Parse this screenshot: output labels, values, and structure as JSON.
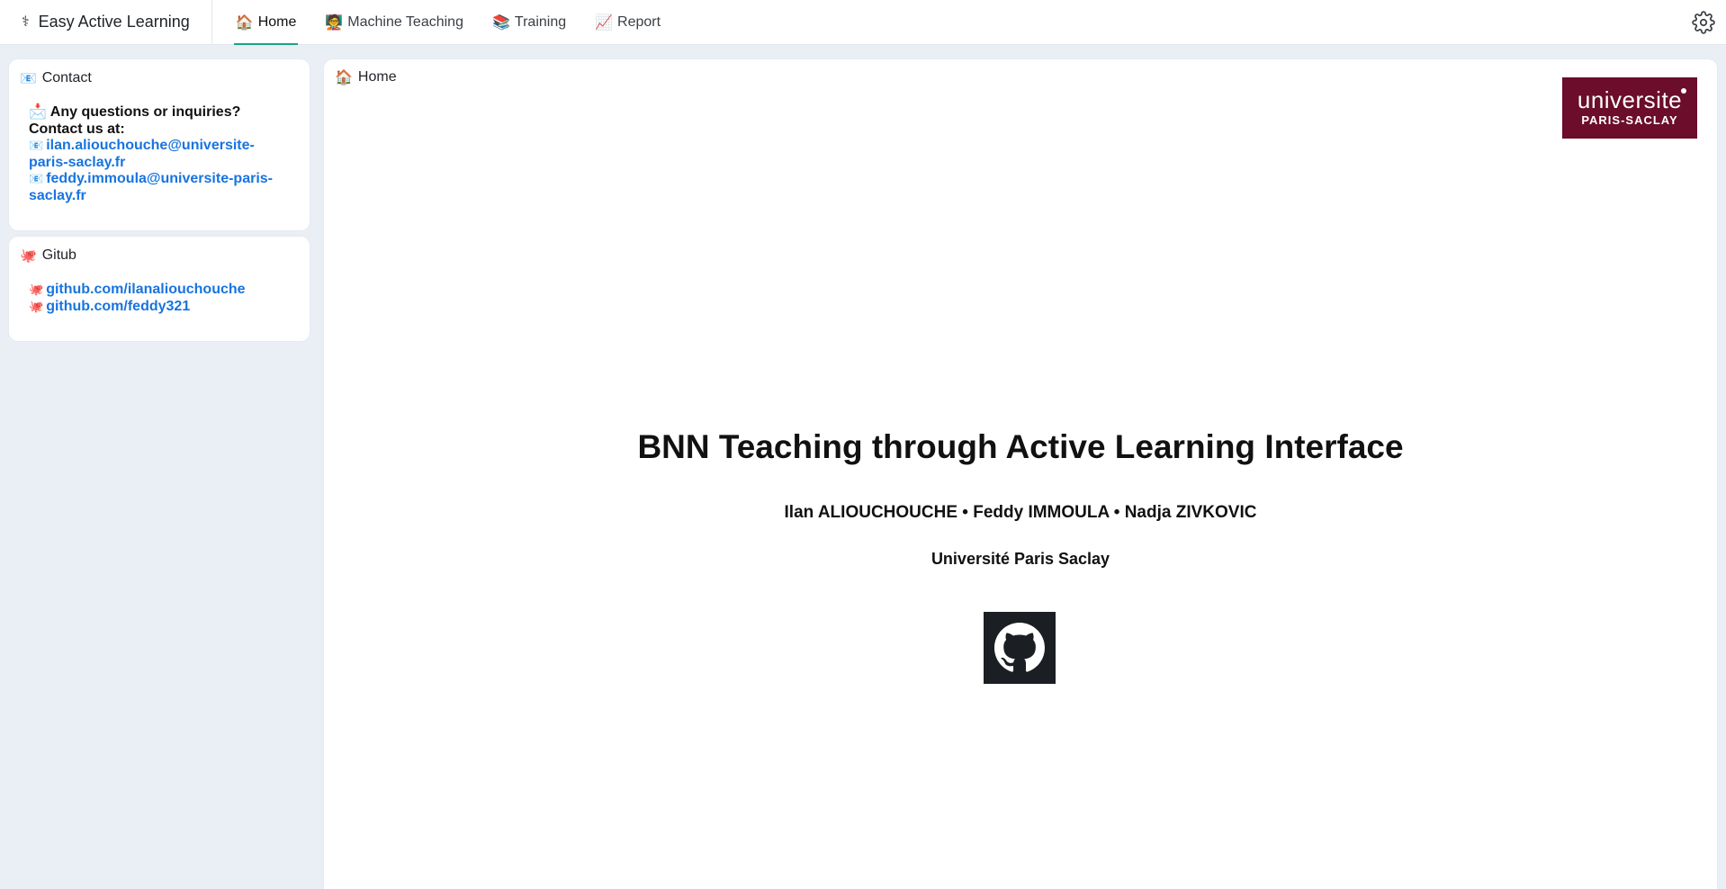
{
  "navbar": {
    "brand_icon": "⚕",
    "brand_title": "Easy Active Learning",
    "tabs": [
      {
        "emoji": "🏠",
        "label": "Home",
        "active": true
      },
      {
        "emoji": "🧑‍🏫",
        "label": "Machine Teaching",
        "active": false
      },
      {
        "emoji": "📚",
        "label": "Training",
        "active": false
      },
      {
        "emoji": "📈",
        "label": "Report",
        "active": false
      }
    ],
    "settings_icon": "gear-icon",
    "accent_color": "#1aa385"
  },
  "sidebar": {
    "contact": {
      "emoji": "📧",
      "title": "Contact",
      "question_emoji": "📩",
      "question": "Any questions or inquiries?",
      "contact_line": "Contact us at:",
      "email_emoji": "📧",
      "emails": [
        "ilan.aliouchouche@universite-paris-saclay.fr",
        "feddy.immoula@universite-paris-saclay.fr"
      ]
    },
    "github": {
      "emoji": "🐙",
      "title": "Gitub",
      "link_emoji": "🐙",
      "links": [
        "github.com/ilanaliouchouche",
        "github.com/feddy321"
      ]
    }
  },
  "main": {
    "header_emoji": "🏠",
    "header": "Home",
    "logo": {
      "line1": "universite",
      "line2": "PARIS-SACLAY",
      "color": "#6b0d2b"
    },
    "title": "BNN Teaching through Active Learning Interface",
    "authors": "Ilan ALIOUCHOUCHE • Feddy IMMOULA • Nadja ZIVKOVIC",
    "affiliation": "Université Paris Saclay",
    "github_button_icon": "github-icon"
  }
}
